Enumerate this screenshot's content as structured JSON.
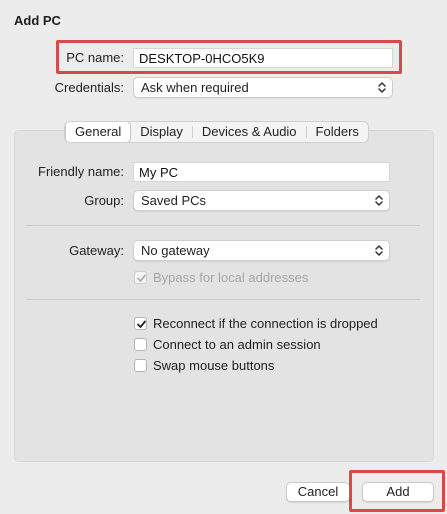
{
  "dialog": {
    "title": "Add PC"
  },
  "pc_name": {
    "label": "PC name:",
    "value": "DESKTOP-0HCO5K9"
  },
  "credentials": {
    "label": "Credentials:",
    "value": "Ask when required"
  },
  "tabs": [
    {
      "label": "General",
      "active": true
    },
    {
      "label": "Display",
      "active": false
    },
    {
      "label": "Devices & Audio",
      "active": false
    },
    {
      "label": "Folders",
      "active": false
    }
  ],
  "general": {
    "friendly_name": {
      "label": "Friendly name:",
      "value": "My PC"
    },
    "group": {
      "label": "Group:",
      "value": "Saved PCs"
    },
    "gateway": {
      "label": "Gateway:",
      "value": "No gateway"
    },
    "bypass": {
      "label": "Bypass for local addresses",
      "checked": true,
      "enabled": false
    },
    "reconnect": {
      "label": "Reconnect if the connection is dropped",
      "checked": true
    },
    "admin_session": {
      "label": "Connect to an admin session",
      "checked": false
    },
    "swap_mouse": {
      "label": "Swap mouse buttons",
      "checked": false
    }
  },
  "buttons": {
    "cancel": "Cancel",
    "add": "Add"
  },
  "colors": {
    "highlight": "#d84a4a",
    "panel": "#e3e3e3",
    "window": "#ececec"
  }
}
